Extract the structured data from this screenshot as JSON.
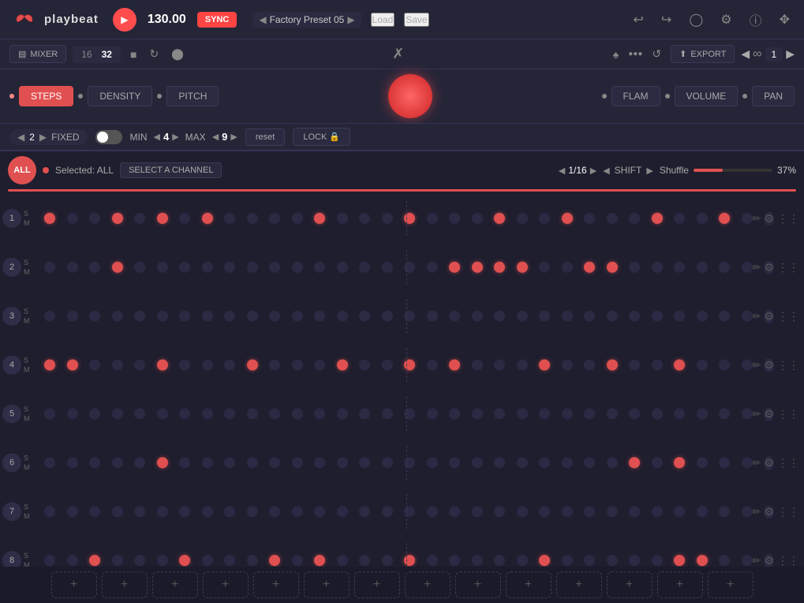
{
  "app": {
    "name": "playbeat"
  },
  "topbar": {
    "bpm": "130.00",
    "sync_label": "SYNC",
    "preset_name": "Factory Preset 05",
    "load_label": "Load",
    "save_label": "Save"
  },
  "controls": {
    "mixer_label": "MIXER",
    "steps_16": "16",
    "steps_32": "32",
    "export_label": "EXPORT",
    "loop_num": "1"
  },
  "params": {
    "steps_label": "STEPS",
    "density_label": "DENSITY",
    "pitch_label": "PITCH",
    "flam_label": "FLAM",
    "volume_label": "VOLUME",
    "pan_label": "PAN"
  },
  "randomize": {
    "fixed_val": "2",
    "fixed_label": "FIXED",
    "min_label": "MIN",
    "min_val": "4",
    "max_label": "MAX",
    "max_val": "9",
    "reset_label": "reset",
    "lock_label": "LOCK"
  },
  "sequencer_header": {
    "all_label": "ALL",
    "selected_label": "Selected: ALL",
    "select_channel_label": "SELECT A CHANNEL",
    "step_size": "1/16",
    "shift_label": "SHIFT",
    "shuffle_label": "Shuffle",
    "shuffle_pct": "37%"
  },
  "channels": [
    {
      "num": "1",
      "active_beats": [
        0,
        3,
        5,
        7,
        12,
        16,
        20,
        23,
        27,
        30
      ],
      "enabled": true
    },
    {
      "num": "2",
      "active_beats": [
        3,
        18,
        19,
        20,
        21,
        24,
        25
      ],
      "enabled": true
    },
    {
      "num": "3",
      "active_beats": [],
      "enabled": false
    },
    {
      "num": "4",
      "active_beats": [
        0,
        1,
        5,
        9,
        13,
        16,
        18,
        22,
        25,
        28
      ],
      "enabled": true
    },
    {
      "num": "5",
      "active_beats": [],
      "enabled": false
    },
    {
      "num": "6",
      "active_beats": [
        5,
        26,
        28
      ],
      "enabled": true
    },
    {
      "num": "7",
      "active_beats": [],
      "enabled": false
    },
    {
      "num": "8",
      "active_beats": [
        2,
        6,
        10,
        12,
        16,
        22,
        28,
        29
      ],
      "enabled": true
    }
  ],
  "add_buttons": [
    "+",
    "+",
    "+",
    "+",
    "+",
    "+",
    "+",
    "+",
    "+",
    "+",
    "+",
    "+",
    "+",
    "+"
  ],
  "colors": {
    "accent": "#e05050",
    "bg_dark": "#1e1e2e",
    "bg_mid": "#252538",
    "dot_active": "#e05050",
    "dot_inactive": "#2a2a45"
  }
}
